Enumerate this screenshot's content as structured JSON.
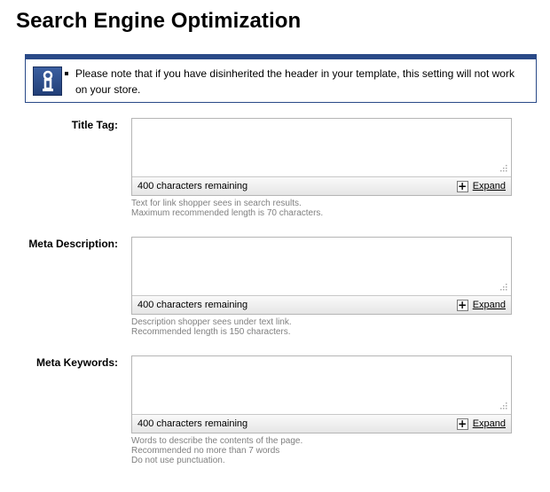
{
  "page": {
    "title": "Search Engine Optimization"
  },
  "notice": {
    "icon": "info-icon",
    "text": "Please note that if you have disinherited the header in your template, this setting will not work on your store."
  },
  "fields": {
    "title_tag": {
      "label": "Title Tag:",
      "value": "",
      "chars_remaining": "400 characters remaining",
      "expand_label": "Expand",
      "help": [
        "Text for link shopper sees in search results.",
        "Maximum recommended length is 70 characters."
      ]
    },
    "meta_description": {
      "label": "Meta Description:",
      "value": "",
      "chars_remaining": "400 characters remaining",
      "expand_label": "Expand",
      "help": [
        "Description shopper sees under text link.",
        "Recommended length is 150 characters."
      ]
    },
    "meta_keywords": {
      "label": "Meta Keywords:",
      "value": "",
      "chars_remaining": "400 characters remaining",
      "expand_label": "Expand",
      "help": [
        "Words to describe the contents of the page.",
        "Recommended no more than 7 words",
        "Do not use punctuation."
      ]
    }
  },
  "colors": {
    "notice_border": "#2a4a88",
    "help_text": "#808080"
  }
}
